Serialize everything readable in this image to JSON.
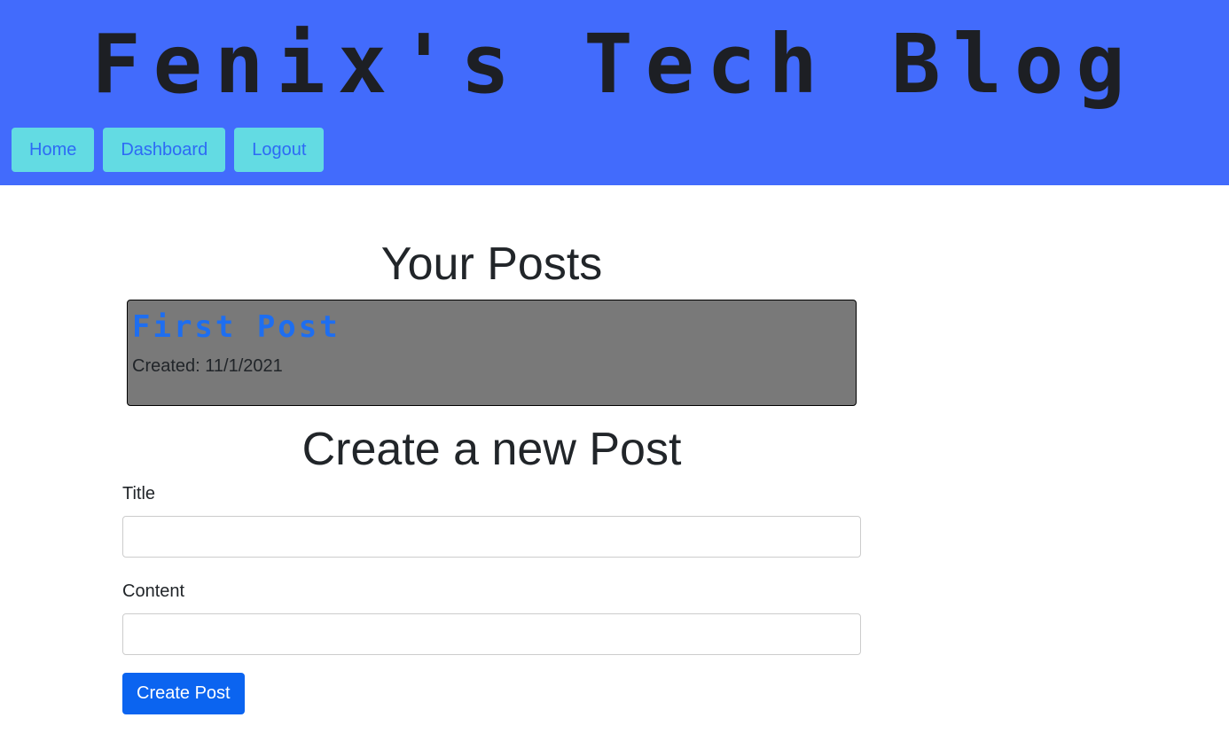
{
  "header": {
    "site_title": "Fenix's Tech Blog",
    "bg_color": "#426bfc"
  },
  "nav": {
    "items": [
      {
        "label": "Home"
      },
      {
        "label": "Dashboard"
      },
      {
        "label": "Logout"
      }
    ],
    "button_color": "#63dbe3"
  },
  "your_posts": {
    "heading": "Your Posts",
    "posts": [
      {
        "title": "First Post",
        "created": "Created: 11/1/2021"
      }
    ]
  },
  "create_post": {
    "heading": "Create a new Post",
    "title_label": "Title",
    "title_value": "",
    "content_label": "Content",
    "content_value": "",
    "submit_label": "Create Post",
    "submit_color": "#0b64f0"
  }
}
